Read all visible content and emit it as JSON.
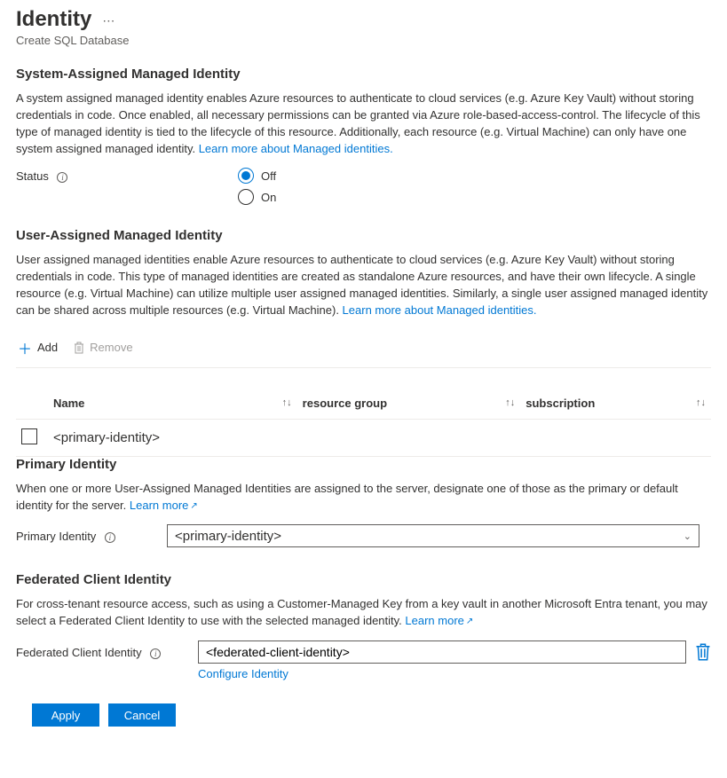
{
  "header": {
    "title": "Identity",
    "subtitle": "Create SQL Database"
  },
  "system_assigned": {
    "title": "System-Assigned Managed Identity",
    "description": "A system assigned managed identity enables Azure resources to authenticate to cloud services (e.g. Azure Key Vault) without storing credentials in code. Once enabled, all necessary permissions can be granted via Azure role-based-access-control. The lifecycle of this type of managed identity is tied to the lifecycle of this resource. Additionally, each resource (e.g. Virtual Machine) can only have one system assigned managed identity. ",
    "learn_more": "Learn more about Managed identities.",
    "status_label": "Status",
    "options": {
      "off": "Off",
      "on": "On"
    },
    "selected": "off"
  },
  "user_assigned": {
    "title": "User-Assigned Managed Identity",
    "description": "User assigned managed identities enable Azure resources to authenticate to cloud services (e.g. Azure Key Vault) without storing credentials in code. This type of managed identities are created as standalone Azure resources, and have their own lifecycle. A single resource (e.g. Virtual Machine) can utilize multiple user assigned managed identities. Similarly, a single user assigned managed identity can be shared across multiple resources (e.g. Virtual Machine). ",
    "learn_more": "Learn more about Managed identities.",
    "toolbar": {
      "add": "Add",
      "remove": "Remove"
    },
    "columns": {
      "name": "Name",
      "resource_group": "resource group",
      "subscription": "subscription"
    },
    "rows": [
      {
        "name": "<primary-identity>",
        "resource_group": "",
        "subscription": ""
      }
    ]
  },
  "primary_identity": {
    "title": "Primary Identity",
    "description": "When one or more User-Assigned Managed Identities are assigned to the server, designate one of those as the primary or default identity for the server. ",
    "learn_more": "Learn more",
    "label": "Primary Identity",
    "value": "<primary-identity>"
  },
  "federated": {
    "title": "Federated Client Identity",
    "description": "For cross-tenant resource access, such as using a Customer-Managed Key from a key vault in another Microsoft Entra tenant, you may select a Federated Client Identity to use with the selected managed identity. ",
    "learn_more": "Learn more",
    "label": "Federated Client Identity",
    "value": "<federated-client-identity>",
    "configure": "Configure Identity"
  },
  "footer": {
    "apply": "Apply",
    "cancel": "Cancel"
  }
}
